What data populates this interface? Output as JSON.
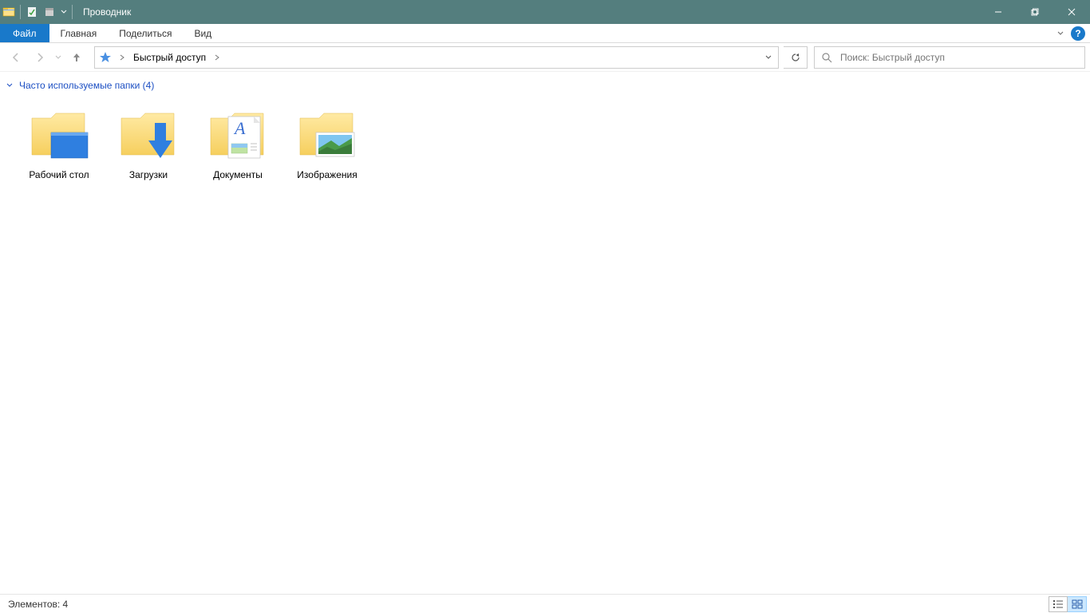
{
  "title": "Проводник",
  "ribbon": {
    "file": "Файл",
    "tabs": [
      "Главная",
      "Поделиться",
      "Вид"
    ]
  },
  "address": {
    "root_label": "Быстрый доступ"
  },
  "search": {
    "placeholder": "Поиск: Быстрый доступ"
  },
  "group": {
    "header": "Часто используемые папки (4)",
    "items": [
      {
        "label": "Рабочий стол",
        "icon": "desktop"
      },
      {
        "label": "Загрузки",
        "icon": "downloads"
      },
      {
        "label": "Документы",
        "icon": "documents"
      },
      {
        "label": "Изображения",
        "icon": "pictures"
      }
    ]
  },
  "status": {
    "count_label": "Элементов: 4"
  }
}
